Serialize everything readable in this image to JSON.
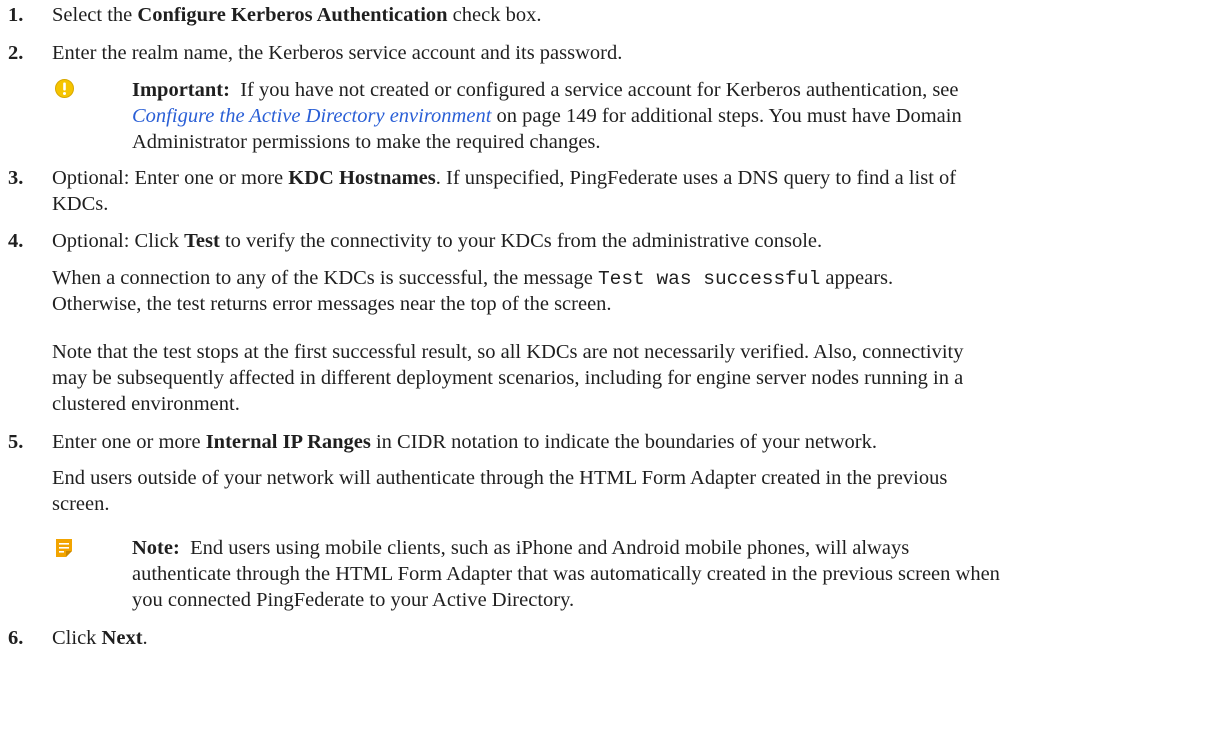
{
  "steps": [
    {
      "num": "1.",
      "pre": "Select the ",
      "bold": "Configure Kerberos Authentication",
      "post": " check box."
    },
    {
      "num": "2.",
      "text": "Enter the realm name, the Kerberos service account and its password."
    },
    {
      "num": "3.",
      "pre": "Optional: Enter one or more ",
      "bold": "KDC Hostnames",
      "post": ". If unspecified, PingFederate uses a DNS query to find a list of",
      "line2": "KDCs."
    },
    {
      "num": "4.",
      "pre": "Optional: Click ",
      "bold": "Test",
      "post": " to verify the connectivity to your KDCs from the administrative console."
    },
    {
      "num": "5.",
      "pre": "Enter one or more ",
      "bold": "Internal IP Ranges",
      "post": " in CIDR notation to indicate the boundaries of your network."
    },
    {
      "num": "6.",
      "pre": "Click ",
      "bold": "Next",
      "post": "."
    }
  ],
  "important": {
    "label": "Important:",
    "text1": "If you have not created or configured a service account for Kerberos authentication, see",
    "link": "Configure the Active Directory environment",
    "text2": " on page 149 for additional steps. You must have Domain",
    "text3": "Administrator permissions to make the required changes."
  },
  "step4_detail": {
    "pre": "When a connection to any of the KDCs is successful, the message ",
    "code": "Test was successful",
    "post": " appears.",
    "line2": "Otherwise, the test returns error messages near the top of the screen.",
    "para2_l1": "Note that the test stops at the first successful result, so all KDCs are not necessarily verified. Also, connectivity",
    "para2_l2": "may be subsequently affected in different deployment scenarios, including for engine server nodes running in a",
    "para2_l3": "clustered environment."
  },
  "step5_detail": {
    "l1": "End users outside of your network will authenticate through the HTML Form Adapter created in the previous",
    "l2": "screen."
  },
  "note": {
    "label": "Note:",
    "l1": "End users using mobile clients, such as iPhone and Android mobile phones, will always",
    "l2": "authenticate through the HTML Form Adapter that was automatically created in the previous screen when",
    "l3": "you connected PingFederate to your Active Directory."
  },
  "icons": {
    "important": "warning-circle-icon",
    "note": "note-icon"
  },
  "colors": {
    "link": "#2a5fd6",
    "important_icon": "#f5c400",
    "note_icon": "#f2a400"
  }
}
